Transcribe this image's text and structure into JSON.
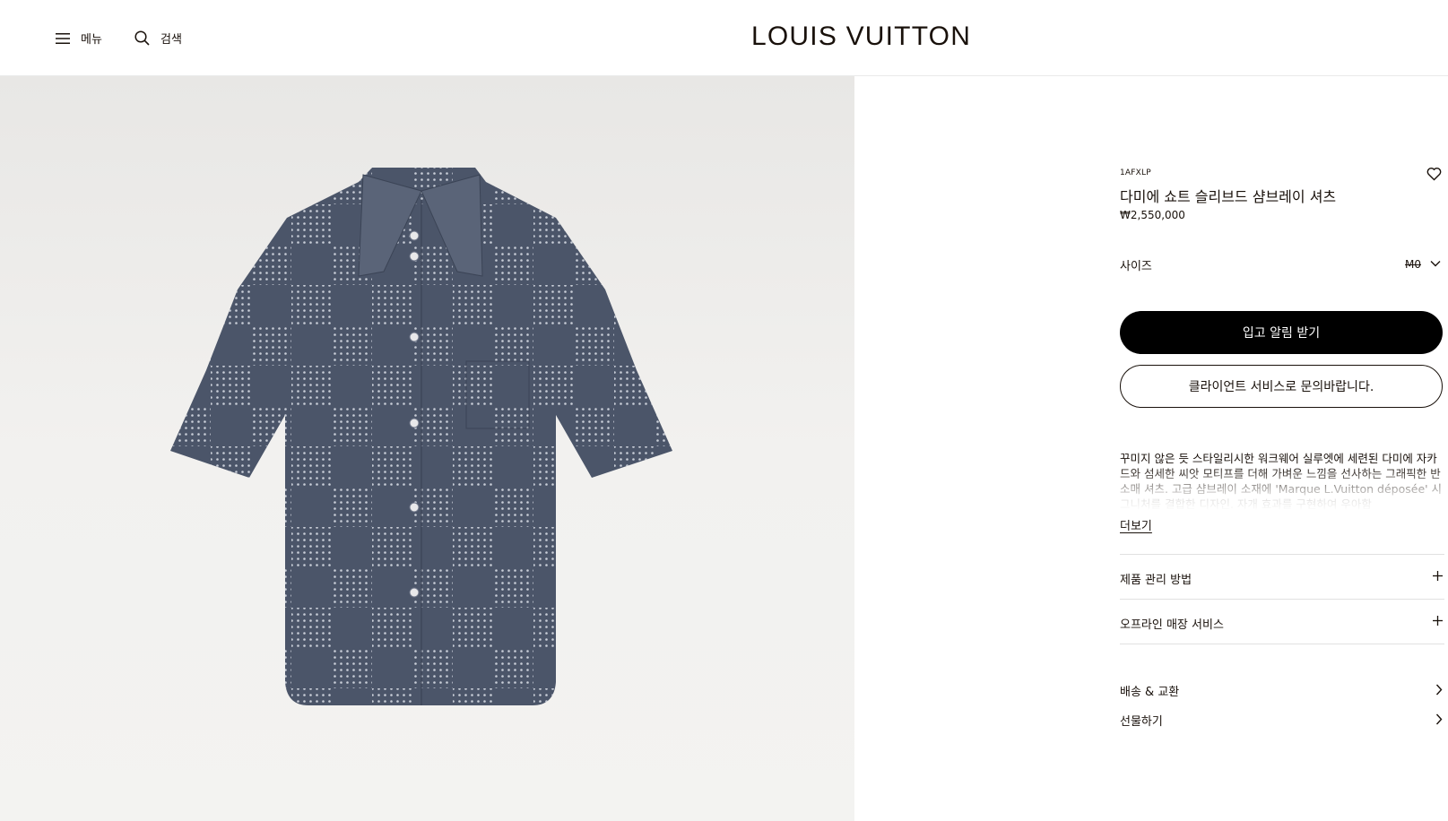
{
  "header": {
    "menu_label": "메뉴",
    "search_label": "검색",
    "logo": "LOUIS VUITTON"
  },
  "product": {
    "sku": "1AFXLP",
    "title": "다미에 쇼트 슬리브드 샴브레이 셔츠",
    "price": "₩2,550,000",
    "size_label": "사이즈",
    "size_value": "M0",
    "primary_button": "입고 알림 받기",
    "secondary_button": "클라이언트 서비스로 문의바랍니다.",
    "description": "꾸미지 않은 듯 스타일리시한 워크웨어 실루엣에 세련된 다미에 자카드와 섬세한 씨앗 모티프를 더해 가벼운 느낌을 선사하는 그래픽한 반소매 셔츠. 고급 샴브레이 소재에 'Marque L.Vuitton déposée' 시그니처를 결합한 디자인. 자개 효과를 구현하여 우아함",
    "more_label": "더보기",
    "accordions": [
      {
        "label": "제품 관리 방법"
      },
      {
        "label": "오프라인 매장 서비스"
      }
    ],
    "links": [
      {
        "label": "배송 & 교환"
      },
      {
        "label": "선물하기"
      }
    ]
  },
  "icons": {
    "menu": "hamburger-icon",
    "search": "search-icon",
    "wishlist": "heart-icon",
    "size_dropdown": "chevron-down-icon",
    "accordion": "plus-icon",
    "link": "chevron-right-icon"
  },
  "colors": {
    "text": "#19110b",
    "primary_button": "#000000",
    "image_background": "#efeeec",
    "shirt": "#4a5468"
  }
}
